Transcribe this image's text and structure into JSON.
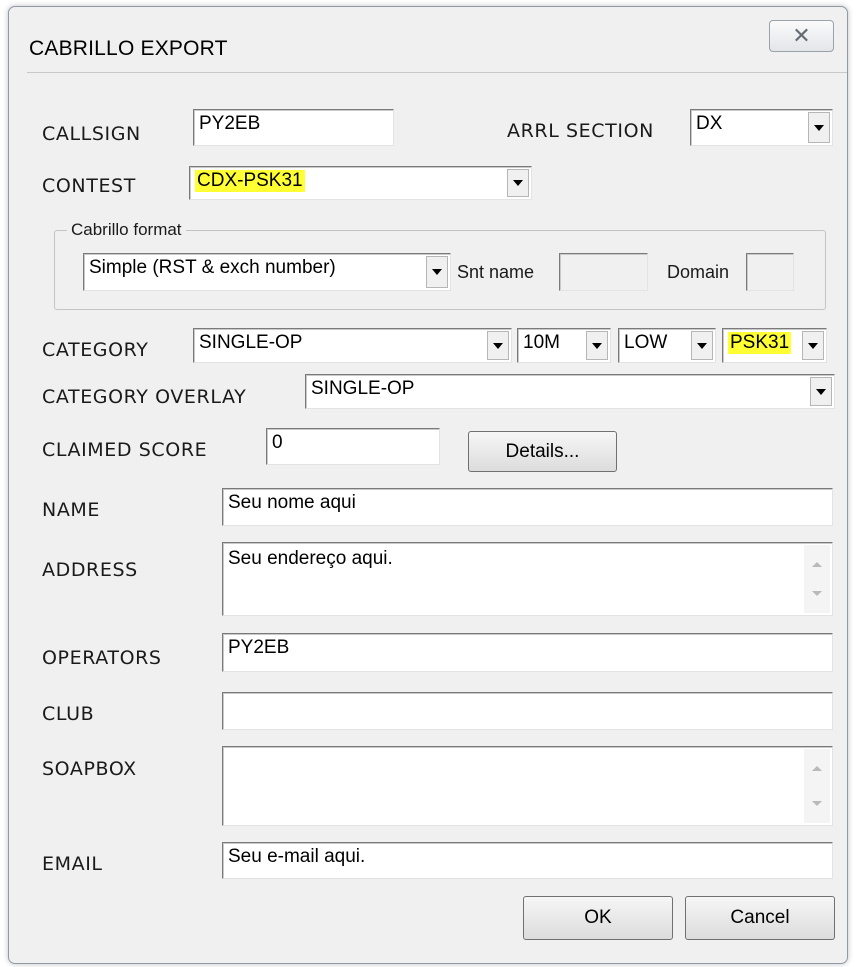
{
  "window": {
    "title": "CABRILLO EXPORT",
    "close_glyph": "✕"
  },
  "callsign": {
    "label": "CALLSIGN",
    "value": "PY2EB"
  },
  "arrl_section": {
    "label": "ARRL SECTION",
    "value": "DX"
  },
  "contest": {
    "label": "CONTEST",
    "value": "CDX-PSK31"
  },
  "cabrillo_format": {
    "group_label": "Cabrillo format",
    "format_value": "Simple (RST & exch number)",
    "snt_name_label": "Snt name",
    "snt_name_value": "",
    "domain_label": "Domain",
    "domain_value": ""
  },
  "category": {
    "label": "CATEGORY",
    "operator_value": "SINGLE-OP",
    "band_value": "10M",
    "power_value": "LOW",
    "mode_value": "PSK31"
  },
  "category_overlay": {
    "label": "CATEGORY OVERLAY",
    "value": "SINGLE-OP"
  },
  "claimed_score": {
    "label": "CLAIMED SCORE",
    "value": "0",
    "details_label": "Details..."
  },
  "name": {
    "label": "NAME",
    "value": "Seu nome aqui"
  },
  "address": {
    "label": "ADDRESS",
    "value": "Seu endereço aqui."
  },
  "operators": {
    "label": "OPERATORS",
    "value": "PY2EB"
  },
  "club": {
    "label": "CLUB",
    "value": ""
  },
  "soapbox": {
    "label": "SOAPBOX",
    "value": ""
  },
  "email": {
    "label": "EMAIL",
    "value": "Seu e-mail aqui."
  },
  "buttons": {
    "ok_label": "OK",
    "cancel_label": "Cancel"
  },
  "colors": {
    "highlight": "#ffff33",
    "dialog_bg": "#f0f0f0"
  }
}
